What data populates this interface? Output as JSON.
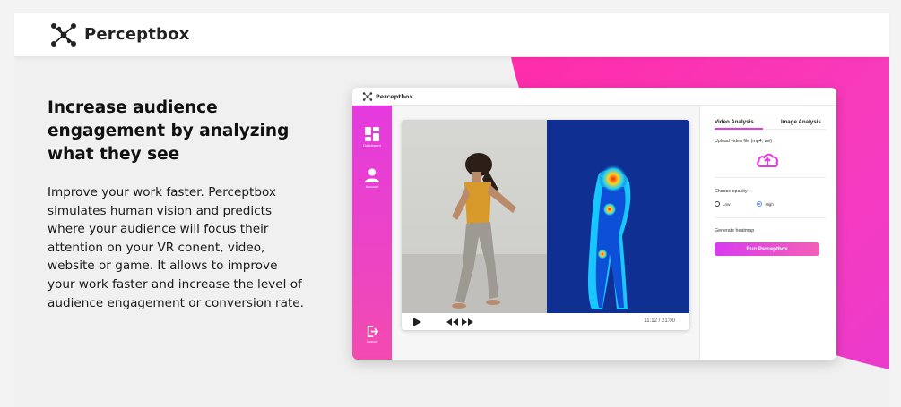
{
  "nav": {
    "brand": "Perceptbox"
  },
  "hero": {
    "title": "Increase audience engagement by analyzing what they see",
    "description": "Improve your work faster. Perceptbox simulates human vision and predicts where your audience will focus their attention on your VR conent, video, website or game. It allows to improve your work faster and increase the level of audience engagement or conversion rate."
  },
  "app": {
    "brand": "Perceptbox",
    "sidebar": {
      "dashboard": "Dashboard",
      "account": "Account",
      "logout": "Logout"
    },
    "player": {
      "time": "11:12 / 21:00"
    },
    "panel": {
      "tab_video": "Video Analysis",
      "tab_image": "Image Analysis",
      "upload_label": "Upload video file (mp4, avi)",
      "opacity_label": "Choose opacity",
      "opacity_options": [
        "Low",
        "High"
      ],
      "opacity_selected": "High",
      "heatmap_label": "Generate heatmap",
      "run_button": "Run Perceptbox"
    }
  },
  "colors": {
    "accent": "#e43adf",
    "pink": "#ff2aa6"
  }
}
